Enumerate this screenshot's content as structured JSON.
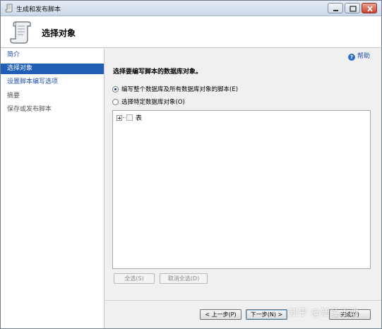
{
  "window": {
    "title": "生成和发布脚本",
    "icon": "scroll-icon",
    "controls": [
      "minimize-icon",
      "maximize-icon",
      "close-icon"
    ]
  },
  "header": {
    "title": "选择对象",
    "icon": "scroll-icon"
  },
  "nav": {
    "items": [
      {
        "label": "简介",
        "state": "link"
      },
      {
        "label": "选择对象",
        "state": "selected"
      },
      {
        "label": "设置脚本编写选项",
        "state": "link"
      },
      {
        "label": "摘要",
        "state": "disabled"
      },
      {
        "label": "保存或发布脚本",
        "state": "disabled"
      }
    ]
  },
  "content": {
    "help_label": "帮助",
    "instruction": "选择要编写脚本的数据库对象。",
    "options": [
      {
        "label": "编写整个数据库及所有数据库对象的脚本(E)",
        "checked": true
      },
      {
        "label": "选择特定数据库对象(O)",
        "checked": false
      }
    ],
    "tree": {
      "items": [
        {
          "label": "表",
          "expanded": false,
          "checked": false
        }
      ]
    },
    "select_all_label": "全选(S)",
    "deselect_all_label": "取消全选(D)"
  },
  "footer": {
    "prev_label": "< 上一步(P)",
    "next_label": "下一步(N) >",
    "finish_label": "完成(F)"
  },
  "watermark": "知乎 @知睡不改",
  "colors": {
    "accent": "#1f5fb7",
    "link": "#1f4fa8",
    "close_button": "#c7412e"
  }
}
